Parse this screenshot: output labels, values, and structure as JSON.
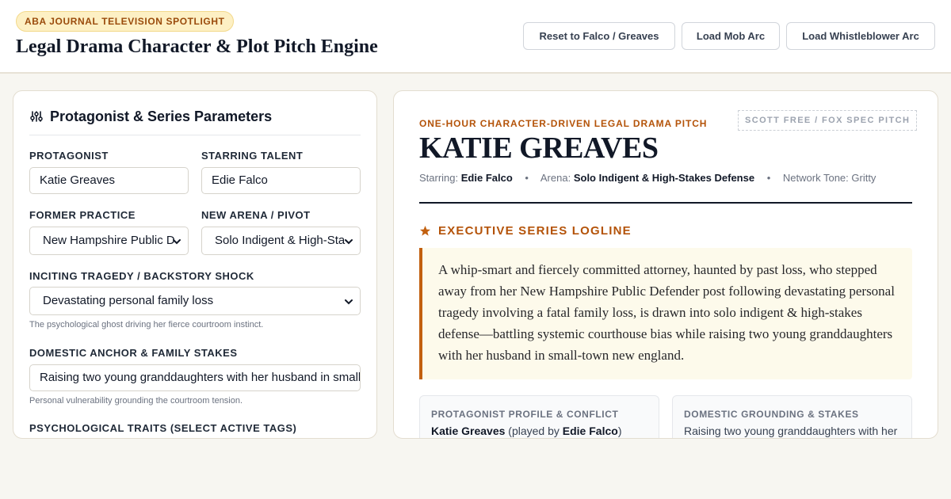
{
  "header": {
    "badge": "ABA JOURNAL TELEVISION SPOTLIGHT",
    "title": "Legal Drama Character & Plot Pitch Engine",
    "buttons": {
      "reset": "Reset to Falco / Greaves",
      "mob": "Load Mob Arc",
      "whistleblower": "Load Whistleblower Arc"
    }
  },
  "form": {
    "panel_title": "Protagonist & Series Parameters",
    "panel_icon": "sliders-icon",
    "protagonist": {
      "label": "PROTAGONIST",
      "value": "Katie Greaves"
    },
    "talent": {
      "label": "STARRING TALENT",
      "value": "Edie Falco"
    },
    "former_practice": {
      "label": "FORMER PRACTICE",
      "value": "New Hampshire Public D"
    },
    "new_arena": {
      "label": "NEW ARENA / PIVOT",
      "value": "Solo Indigent & High-Sta"
    },
    "tragedy": {
      "label": "INCITING TRAGEDY / BACKSTORY SHOCK",
      "value": "Devastating personal family loss",
      "help": "The psychological ghost driving her fierce courtroom instinct."
    },
    "domestic": {
      "label": "DOMESTIC ANCHOR & FAMILY STAKES",
      "value": "Raising two young granddaughters with her husband in small-",
      "help": "Personal vulnerability grounding the courtroom tension."
    },
    "traits": {
      "label": "PSYCHOLOGICAL TRAITS (SELECT ACTIVE TAGS)"
    }
  },
  "pitch": {
    "kicker": "ONE-HOUR CHARACTER-DRIVEN LEGAL DRAMA PITCH",
    "stamp": "SCOTT FREE / FOX SPEC PITCH",
    "name": "KATIE GREAVES",
    "meta": {
      "starring_label": "Starring:",
      "starring": "Edie Falco",
      "arena_label": "Arena:",
      "arena": "Solo Indigent & High-Stakes Defense",
      "tone": "Network Tone: Gritty",
      "separator": "•"
    },
    "logline_title": "EXECUTIVE SERIES LOGLINE",
    "logline_icon": "star-icon",
    "logline": "A whip-smart and fiercely committed attorney, haunted by past loss, who stepped away from her New Hampshire Public Defender post following devastating personal tragedy involving a fatal family loss, is drawn into solo indigent & high-stakes defense—battling systemic courthouse bias while raising two young granddaughters with her husband in small-town new england.",
    "cards": {
      "profile": {
        "title": "PROTAGONIST PROFILE & CONFLICT",
        "name": "Katie Greaves",
        "played_by": "(played by",
        "talent": "Edie Falco",
        "close": ")"
      },
      "domestic": {
        "title": "DOMESTIC GROUNDING & STAKES",
        "body": "Raising two young granddaughters with her"
      }
    }
  },
  "colors": {
    "accent": "#b45309",
    "badge_bg": "#fdf0c4",
    "logline_bg": "#fdfaeb",
    "page_bg": "#f7f6f1"
  }
}
